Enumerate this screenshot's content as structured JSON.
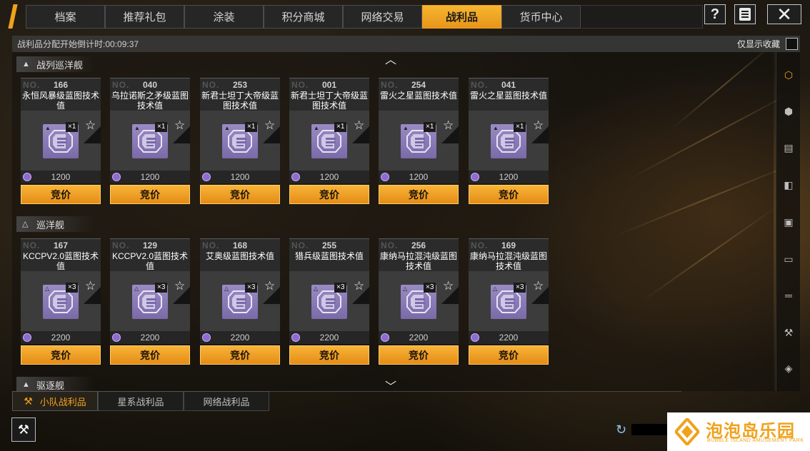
{
  "topbar": {
    "tabs": [
      {
        "label": "档案",
        "active": false
      },
      {
        "label": "推荐礼包",
        "active": false
      },
      {
        "label": "涂装",
        "active": false
      },
      {
        "label": "积分商城",
        "active": false
      },
      {
        "label": "网络交易",
        "active": false
      },
      {
        "label": "战利品",
        "active": true
      },
      {
        "label": "货币中心",
        "active": false
      }
    ],
    "help_label": "?",
    "close_label": "✕"
  },
  "timer": {
    "text": "战利品分配开始倒计时:00:09:37",
    "favorites_label": "仅显示收藏"
  },
  "sections": [
    {
      "title": "战列巡洋舰",
      "cards": [
        {
          "no_label": "NO.",
          "number": "166",
          "name": "永恒风暴级蓝图技术值",
          "qty": "×1",
          "price": "1200",
          "bid_label": "竞价"
        },
        {
          "no_label": "NO.",
          "number": "040",
          "name": "乌拉诺斯之矛级蓝图技术值",
          "qty": "×1",
          "price": "1200",
          "bid_label": "竞价"
        },
        {
          "no_label": "NO.",
          "number": "253",
          "name": "新君士坦丁大帝级蓝图技术值",
          "qty": "×1",
          "price": "1200",
          "bid_label": "竞价"
        },
        {
          "no_label": "NO.",
          "number": "001",
          "name": "新君士坦丁大帝级蓝图技术值",
          "qty": "×1",
          "price": "1200",
          "bid_label": "竞价"
        },
        {
          "no_label": "NO.",
          "number": "254",
          "name": "雷火之星蓝图技术值",
          "qty": "×1",
          "price": "1200",
          "bid_label": "竞价"
        },
        {
          "no_label": "NO.",
          "number": "041",
          "name": "雷火之星蓝图技术值",
          "qty": "×1",
          "price": "1200",
          "bid_label": "竞价"
        }
      ]
    },
    {
      "title": "巡洋舰",
      "cards": [
        {
          "no_label": "NO.",
          "number": "167",
          "name": "KCCPV2.0蓝图技术值",
          "qty": "×3",
          "price": "2200",
          "bid_label": "竞价"
        },
        {
          "no_label": "NO.",
          "number": "129",
          "name": "KCCPV2.0蓝图技术值",
          "qty": "×3",
          "price": "2200",
          "bid_label": "竞价"
        },
        {
          "no_label": "NO.",
          "number": "168",
          "name": "艾奥级蓝图技术值",
          "qty": "×3",
          "price": "2200",
          "bid_label": "竞价"
        },
        {
          "no_label": "NO.",
          "number": "255",
          "name": "猎兵级蓝图技术值",
          "qty": "×3",
          "price": "2200",
          "bid_label": "竞价"
        },
        {
          "no_label": "NO.",
          "number": "256",
          "name": "康纳马拉混沌级蓝图技术值",
          "qty": "×3",
          "price": "2200",
          "bid_label": "竞价"
        },
        {
          "no_label": "NO.",
          "number": "169",
          "name": "康纳马拉混沌级蓝图技术值",
          "qty": "×3",
          "price": "2200",
          "bid_label": "竞价"
        }
      ]
    },
    {
      "title": "驱逐舰",
      "cards": []
    }
  ],
  "bottom_tabs": [
    {
      "label": "小队战利品",
      "active": true
    },
    {
      "label": "星系战利品",
      "active": false
    },
    {
      "label": "网络战利品",
      "active": false
    }
  ],
  "watermark": {
    "title": "泡泡岛乐园",
    "subtitle": "BUBBLE ISLAND AMUSEMENT PARK"
  },
  "colors": {
    "accent": "#f0a21c",
    "item_purple": "#8a7bb8",
    "panel_gray": "#3c3c3c"
  }
}
